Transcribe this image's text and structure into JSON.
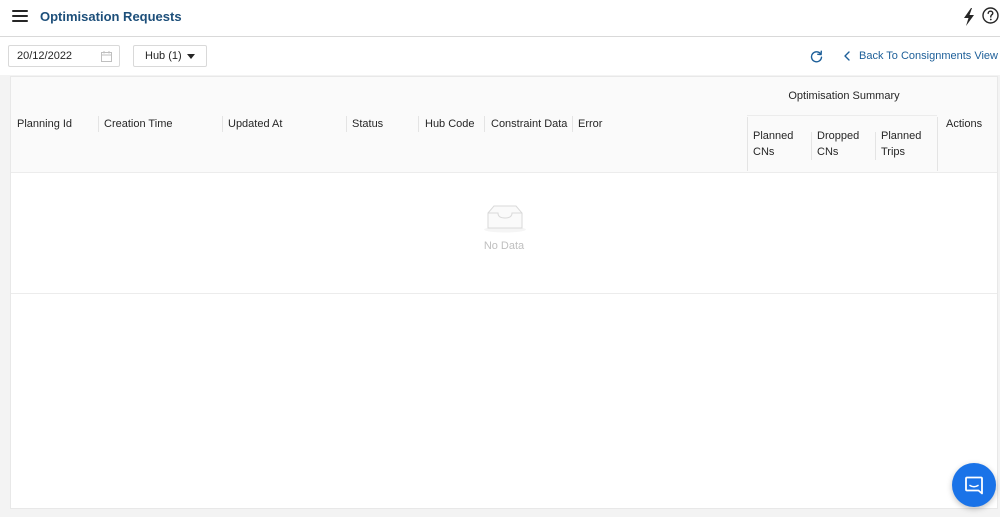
{
  "header": {
    "title": "Optimisation Requests",
    "menu_icon": "hamburger-menu-icon",
    "actions": [
      "lightning-bolt-icon",
      "help-circle-icon"
    ]
  },
  "filters": {
    "date_value": "20/12/2022",
    "date_icon": "calendar-icon",
    "hub_value": "Hub (1)",
    "refresh_icon": "refresh-icon",
    "back_link_label": "Back To Consignments View"
  },
  "table": {
    "columns": {
      "planning_id": "Planning Id",
      "creation_time": "Creation Time",
      "updated_at": "Updated At",
      "status": "Status",
      "hub_code": "Hub Code",
      "constraint_data": "Constraint Data",
      "error": "Error",
      "actions": "Actions"
    },
    "group": {
      "title": "Optimisation Summary",
      "sub": {
        "planned_cns_1": "Planned",
        "planned_cns_2": "CNs",
        "dropped_cns_1": "Dropped",
        "dropped_cns_2": "CNs",
        "planned_trips_1": "Planned",
        "planned_trips_2": "Trips"
      }
    },
    "empty_text": "No Data"
  },
  "colors": {
    "accent": "#1d4f7a",
    "link": "#1d5f99",
    "chat_button": "#1a73e8"
  },
  "chat_icon": "chat-bubble-icon"
}
